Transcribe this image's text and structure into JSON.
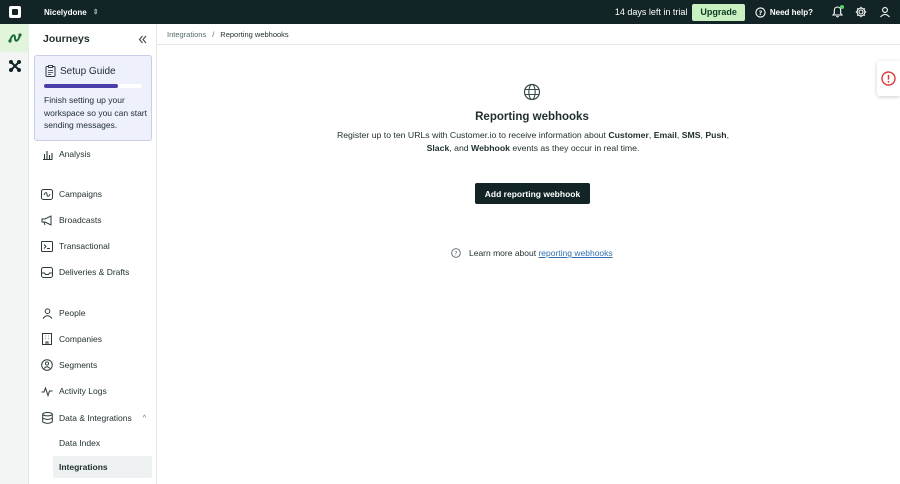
{
  "topbar": {
    "workspace": "Nicelydone",
    "trial_text": "14 days left in trial",
    "upgrade_label": "Upgrade",
    "help_label": "Need help?"
  },
  "sidebar": {
    "title": "Journeys",
    "setup_guide": {
      "title": "Setup Guide",
      "progress": 0.75,
      "text": "Finish setting up your workspace so you can start sending messages."
    },
    "items": [
      {
        "label": "Analysis",
        "icon": "bar-chart-icon"
      },
      {
        "label": "Campaigns",
        "icon": "campaigns-icon"
      },
      {
        "label": "Broadcasts",
        "icon": "megaphone-icon"
      },
      {
        "label": "Transactional",
        "icon": "terminal-icon"
      },
      {
        "label": "Deliveries & Drafts",
        "icon": "inbox-icon"
      },
      {
        "label": "People",
        "icon": "person-icon"
      },
      {
        "label": "Companies",
        "icon": "building-icon"
      },
      {
        "label": "Segments",
        "icon": "segments-icon"
      },
      {
        "label": "Activity Logs",
        "icon": "activity-icon"
      },
      {
        "label": "Data & Integrations",
        "icon": "database-icon"
      }
    ],
    "subitems": [
      {
        "label": "Data Index"
      },
      {
        "label": "Integrations"
      }
    ]
  },
  "breadcrumb": {
    "parent": "Integrations",
    "separator": "/",
    "current": "Reporting webhooks"
  },
  "main": {
    "title": "Reporting webhooks",
    "desc_part1": "Register up to ten URLs with Customer.io to receive information about ",
    "desc_customer": "Customer",
    "desc_sep1": ", ",
    "desc_email": "Email",
    "desc_sep2": ", ",
    "desc_sms": "SMS",
    "desc_sep3": ", ",
    "desc_push": "Push",
    "desc_sep4": ", ",
    "desc_slack": "Slack",
    "desc_and": ", and ",
    "desc_webhook": "Webhook",
    "desc_end": " events as they occur in real time.",
    "add_button": "Add reporting webhook",
    "learn_prefix": "Learn more about ",
    "learn_link": "reporting webhooks"
  },
  "colors": {
    "topbar_bg": "#122426",
    "upgrade_bg": "#c9f0c1",
    "progress_fill": "#4a3fa8",
    "link": "#2e6fb0",
    "alert": "#d93a3a"
  }
}
